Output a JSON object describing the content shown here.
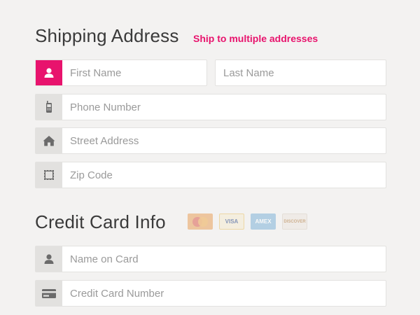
{
  "shipping": {
    "title": "Shipping Address",
    "multi_link": "Ship to multiple addresses",
    "first_name": {
      "value": "",
      "placeholder": "First Name",
      "icon": "user-icon"
    },
    "last_name": {
      "value": "",
      "placeholder": "Last Name"
    },
    "phone": {
      "value": "",
      "placeholder": "Phone Number",
      "icon": "mobile-phone-icon"
    },
    "street": {
      "value": "",
      "placeholder": "Street Address",
      "icon": "home-icon"
    },
    "zip": {
      "value": "",
      "placeholder": "Zip Code",
      "icon": "stamp-icon"
    }
  },
  "credit": {
    "title": "Credit Card Info",
    "cards": [
      {
        "name": "MasterCard",
        "icon": "mastercard-logo",
        "color": "#e9a25b"
      },
      {
        "name": "VISA",
        "icon": "visa-logo",
        "color": "#e9c36b"
      },
      {
        "name": "AMEX",
        "icon": "amex-logo",
        "color": "#7fb3d8"
      },
      {
        "name": "DISCOVER",
        "icon": "discover-logo",
        "color": "#d9cfc2"
      }
    ],
    "name_on_card": {
      "value": "",
      "placeholder": "Name on Card",
      "icon": "user-icon"
    },
    "card_number": {
      "value": "",
      "placeholder": "Credit Card Number",
      "icon": "credit-card-icon"
    }
  },
  "colors": {
    "accent": "#e8136d",
    "background": "#f3f2f1",
    "icon_box": "#e2e1df",
    "icon": "#6b6b6b"
  }
}
